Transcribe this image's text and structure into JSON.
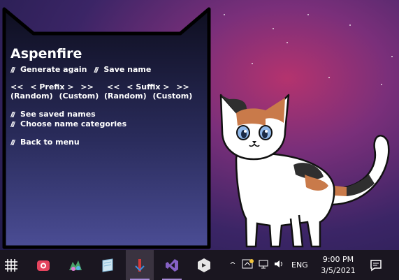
{
  "generator": {
    "name": "Aspenfire",
    "actions": {
      "generate": "Generate again",
      "save": "Save name"
    },
    "prefix": {
      "prev": "<<",
      "label": "< Prefix >",
      "next": ">>",
      "random": "(Random)",
      "custom": "(Custom)"
    },
    "suffix": {
      "prev": "<<",
      "label": "< Suffix >",
      "next": ">>",
      "random": "(Random)",
      "custom": "(Custom)"
    },
    "menu": {
      "see_saved": "See saved names",
      "categories": "Choose name categories",
      "back": "Back to menu"
    }
  },
  "taskbar": {
    "apps": [
      "grid-app-icon",
      "camera-app-icon",
      "game-app-icon",
      "notepad-app-icon",
      "paint-app-icon",
      "visual-studio-icon",
      "editor-app-icon"
    ],
    "tray": {
      "language": "ENG"
    },
    "clock": {
      "time": "9:00 PM",
      "date": "3/5/2021"
    }
  },
  "colors": {
    "accent": "#a78ad6",
    "panel_top": "#0e0e1f",
    "panel_bottom": "#4b4d95"
  }
}
